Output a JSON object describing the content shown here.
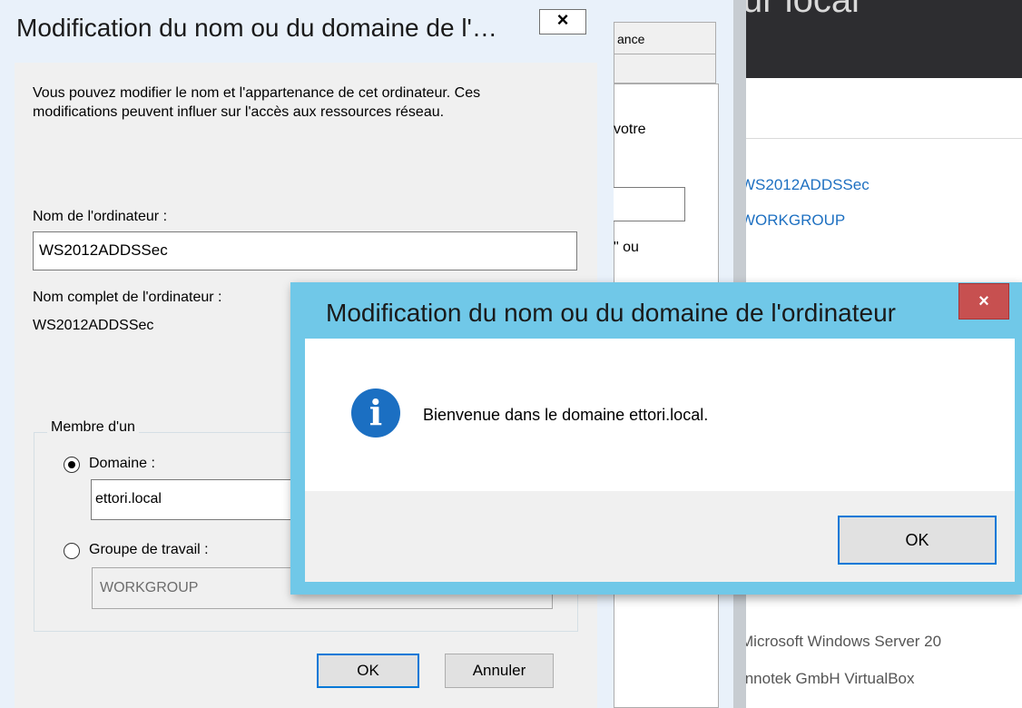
{
  "background_window": {
    "title_fragment": "ur local",
    "computer_name": "WS2012ADDSSec",
    "workgroup": "WORKGROUP",
    "os": "Microsoft Windows Server 20",
    "manufacturer": "Innotek GmbH VirtualBox"
  },
  "system_properties": {
    "tab_fragment": "ance",
    "text_fragment_1": "votre",
    "text_fragment_2": "\" ou"
  },
  "rename_dialog": {
    "title": "Modification du nom ou du domaine de l'…",
    "close_glyph": "×",
    "description": "Vous pouvez modifier le nom et l'appartenance de cet ordinateur. Ces modifications peuvent influer sur l'accès aux ressources réseau.",
    "computer_name_label": "Nom de l'ordinateur :",
    "computer_name_value": "WS2012ADDSSec",
    "full_name_label": "Nom complet de l'ordinateur :",
    "full_name_value": "WS2012ADDSSec",
    "member_of_label": "Membre d'un",
    "domain_label": "Domaine :",
    "domain_value": "ettori.local",
    "domain_selected": true,
    "workgroup_label": "Groupe de travail :",
    "workgroup_value": "WORKGROUP",
    "ok_label": "OK",
    "cancel_label": "Annuler"
  },
  "message_box": {
    "title": "Modification du nom ou du domaine de l'ordinateur",
    "close_glyph": "×",
    "icon": "info-icon",
    "icon_glyph": "i",
    "message": "Bienvenue dans le domaine ettori.local.",
    "ok_label": "OK"
  },
  "colors": {
    "accent_blue": "#0078d7",
    "info_icon_blue": "#1b6fc2",
    "close_red": "#c75050",
    "msgbox_frame": "#70c8e8",
    "link_blue": "#1e70c1"
  }
}
